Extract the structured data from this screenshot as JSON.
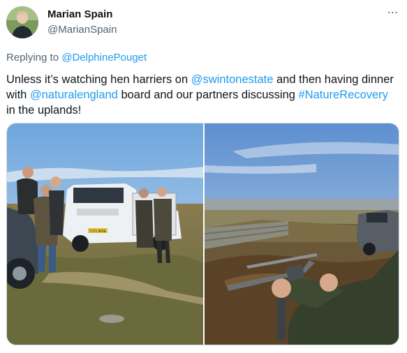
{
  "author": {
    "display_name": "Marian Spain",
    "handle": "@MarianSpain"
  },
  "more_icon": "more-horizontal-icon",
  "more_glyph": "⋯",
  "reply": {
    "prefix": "Replying to",
    "mention": "@DelphinePouget"
  },
  "text": {
    "part1": "Unless it’s watching hen harriers on ",
    "mention1": "@swintonestate",
    "part2": " and then having dinner with ",
    "mention2": "@naturalengland",
    "part3": " board and our partners discussing ",
    "hashtag": "#NatureRecovery",
    "part4": " in the uplands!"
  },
  "media": {
    "photos": [
      {
        "plate_text": "YJ71 WSE"
      },
      {
        "plate_text": ""
      }
    ]
  },
  "colors": {
    "link": "#1d9bf0",
    "secondary_text": "#536471",
    "primary_text": "#0f1419"
  }
}
